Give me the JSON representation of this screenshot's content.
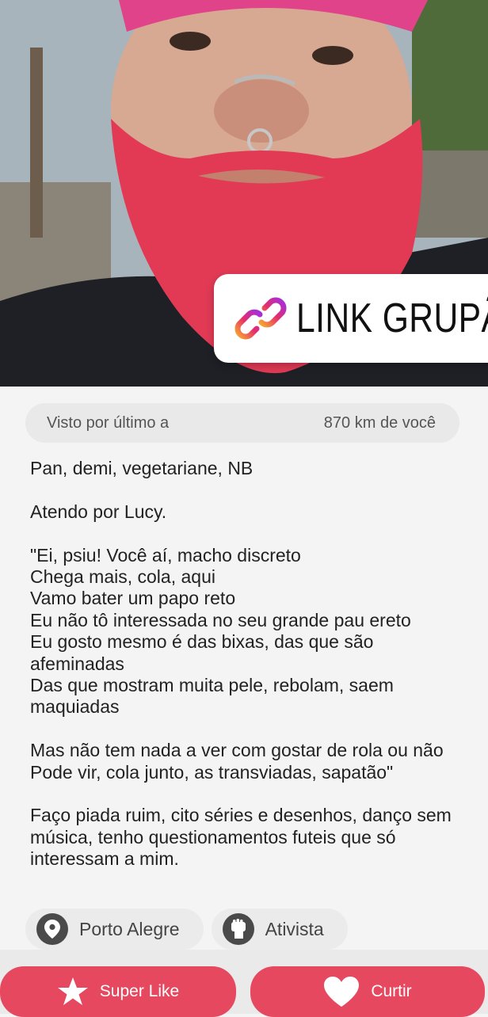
{
  "photo": {
    "description_icon": "profile-photo",
    "sticker": {
      "label": "LINK GRUPÃ",
      "icon": "link-icon"
    }
  },
  "info": {
    "last_seen": "Visto por último a",
    "distance": "870 km de você"
  },
  "bio": {
    "line1": "Pan, demi, vegetariane, NB",
    "line2": "Atendo por Lucy.",
    "lyrics1": "\"Ei, psiu! Você aí, macho discreto\nChega mais, cola, aqui\nVamo bater um papo reto\nEu não tô interessada no seu grande pau ereto\nEu gosto mesmo é das bixas, das que são afeminadas\nDas que mostram muita pele, rebolam, saem maquiadas",
    "lyrics2": "Mas não tem nada a ver com gostar de rola ou não\nPode vir, cola junto, as transviadas, sapatão\"",
    "closing": "Faço piada ruim, cito séries e desenhos, danço sem música, tenho questionamentos futeis que só interessam a mim."
  },
  "tags": [
    {
      "label": "Porto Alegre",
      "icon": "location-pin-icon"
    },
    {
      "label": "Ativista",
      "icon": "raised-fist-icon"
    }
  ],
  "actions": {
    "super_like": "Super Like",
    "like": "Curtir"
  },
  "colors": {
    "accent": "#e5485f",
    "pill_bg": "#e9e9e9",
    "page_bg": "#f4f4f4"
  }
}
